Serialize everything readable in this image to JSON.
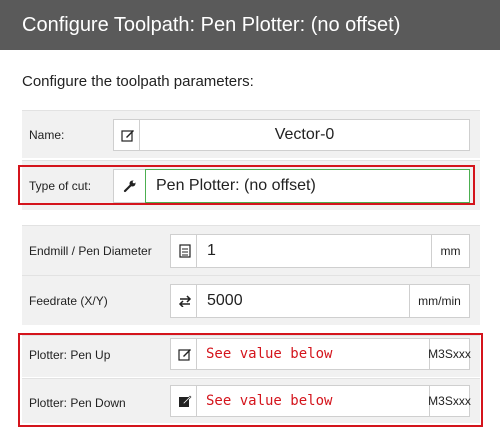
{
  "header": {
    "title": "Configure Toolpath: Pen Plotter: (no offset)"
  },
  "intro": "Configure the toolpath parameters:",
  "fields": {
    "name": {
      "label": "Name:",
      "value": "Vector-0",
      "icon": "edit-icon"
    },
    "type_of_cut": {
      "label": "Type of cut:",
      "value": "Pen Plotter: (no offset)",
      "icon": "wrench-icon"
    },
    "diameter": {
      "label": "Endmill / Pen Diameter",
      "value": "1",
      "unit": "mm",
      "icon": "layers-icon"
    },
    "feedrate": {
      "label": "Feedrate (X/Y)",
      "value": "5000",
      "unit": "mm/min",
      "icon": "arrows-icon"
    },
    "pen_up": {
      "label": "Plotter: Pen Up",
      "placeholder": "See value below",
      "unit": "M3Sxxx",
      "icon": "edit-icon"
    },
    "pen_down": {
      "label": "Plotter: Pen Down",
      "placeholder": "See value below",
      "unit": "M3Sxxx",
      "icon": "edit-filled-icon"
    }
  },
  "colors": {
    "highlight": "#d4141c",
    "header_bg": "#5a5a5a",
    "valid_border": "#4caf50"
  }
}
